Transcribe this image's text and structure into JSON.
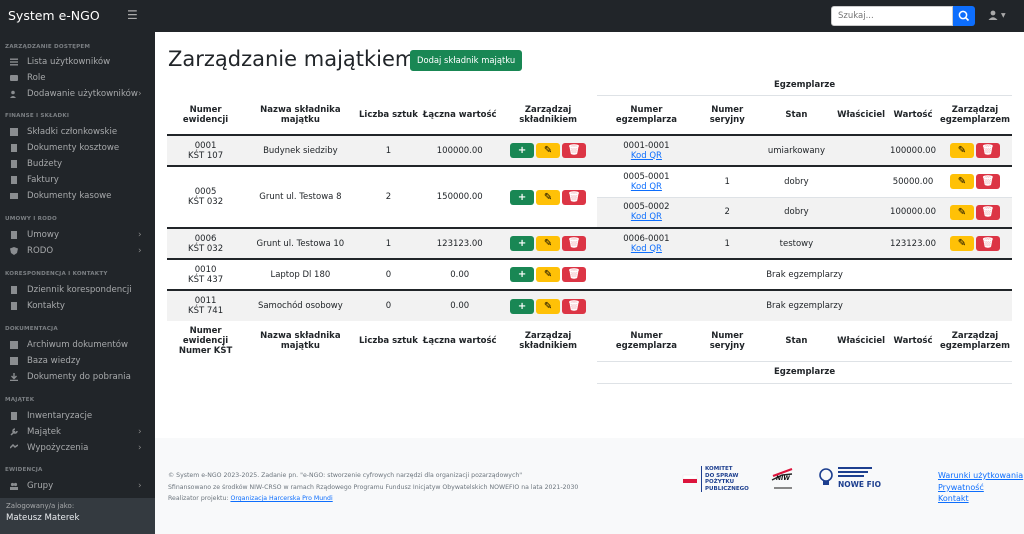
{
  "app": {
    "title": "System e-NGO",
    "search_placeholder": "Szukaj..."
  },
  "sidebar": {
    "sections": [
      {
        "label": "Zarządzanie dostępem",
        "items": [
          {
            "label": "Lista użytkowników",
            "icon": "list-icon"
          },
          {
            "label": "Role",
            "icon": "id-card-icon"
          },
          {
            "label": "Dodawanie użytkowników",
            "icon": "add-user-icon",
            "submenu": true
          }
        ]
      },
      {
        "label": "Finanse i składki",
        "items": [
          {
            "label": "Składki członkowskie",
            "icon": "table-icon"
          },
          {
            "label": "Dokumenty kosztowe",
            "icon": "receipt-icon"
          },
          {
            "label": "Budżety",
            "icon": "file-icon"
          },
          {
            "label": "Faktury",
            "icon": "invoice-icon"
          },
          {
            "label": "Dokumenty kasowe",
            "icon": "cash-icon"
          }
        ]
      },
      {
        "label": "Umowy i RODO",
        "items": [
          {
            "label": "Umowy",
            "icon": "document-icon",
            "submenu": true
          },
          {
            "label": "RODO",
            "icon": "shield-icon",
            "submenu": true
          }
        ]
      },
      {
        "label": "Korespondencja i kontakty",
        "items": [
          {
            "label": "Dziennik korespondencji",
            "icon": "journal-icon"
          },
          {
            "label": "Kontakty",
            "icon": "contact-icon"
          }
        ]
      },
      {
        "label": "Dokumentacja",
        "items": [
          {
            "label": "Archiwum dokumentów",
            "icon": "archive-icon"
          },
          {
            "label": "Baza wiedzy",
            "icon": "book-icon"
          },
          {
            "label": "Dokumenty do pobrania",
            "icon": "download-icon"
          }
        ]
      },
      {
        "label": "Majątek",
        "items": [
          {
            "label": "Inwentaryzacje",
            "icon": "clipboard-icon"
          },
          {
            "label": "Majątek",
            "icon": "wrench-icon",
            "submenu": true
          },
          {
            "label": "Wypożyczenia",
            "icon": "handshake-icon",
            "submenu": true
          }
        ]
      },
      {
        "label": "Ewidencja",
        "items": [
          {
            "label": "Grupy",
            "icon": "group-icon",
            "submenu": true
          }
        ]
      }
    ],
    "logged_in_label": "Zalogowany/a jako:",
    "user_name": "Mateusz Materek"
  },
  "page": {
    "title": "Zarządzanie majątkiem",
    "add_button": "Dodaj składnik majątku"
  },
  "table": {
    "group_header": "Egzemplarze",
    "headers": [
      "Numer ewidencji",
      "Nazwa składnika majątku",
      "Liczba sztuk",
      "Łączna wartość",
      "Zarządzaj składnikiem",
      "Numer egzemplarza",
      "Numer seryjny",
      "Stan",
      "Właściciel",
      "Wartość",
      "Zarządzaj egzemplarzem"
    ],
    "footer_headers": [
      "Numer ewidencji Numer KŚT",
      "Nazwa składnika majątku",
      "Liczba sztuk",
      "Łączna wartość",
      "Zarządzaj składnikiem",
      "Numer egzemplarza",
      "Numer seryjny",
      "Stan",
      "Właściciel",
      "Wartość",
      "Zarządzaj egzemplarzem"
    ],
    "qr_label": "Kod QR",
    "no_copies": "Brak egzemplarzy",
    "rows": [
      {
        "ev": "0001",
        "kst": "KŚT 107",
        "name": "Budynek siedziby",
        "qty": "1",
        "total": "100000.00",
        "copies": [
          {
            "num": "0001-0001",
            "serial": "",
            "state": "umiarkowany",
            "owner": "",
            "value": "100000.00"
          }
        ]
      },
      {
        "ev": "0005",
        "kst": "KŚT 032",
        "name": "Grunt ul. Testowa 8",
        "qty": "2",
        "total": "150000.00",
        "copies": [
          {
            "num": "0005-0001",
            "serial": "1",
            "state": "dobry",
            "owner": "",
            "value": "50000.00"
          },
          {
            "num": "0005-0002",
            "serial": "2",
            "state": "dobry",
            "owner": "",
            "value": "100000.00"
          }
        ]
      },
      {
        "ev": "0006",
        "kst": "KŚT 032",
        "name": "Grunt ul. Testowa 10",
        "qty": "1",
        "total": "123123.00",
        "copies": [
          {
            "num": "0006-0001",
            "serial": "1",
            "state": "testowy",
            "owner": "",
            "value": "123123.00"
          }
        ]
      },
      {
        "ev": "0010",
        "kst": "KŚT 437",
        "name": "Laptop Dl 180",
        "qty": "0",
        "total": "0.00",
        "copies": []
      },
      {
        "ev": "0011",
        "kst": "KŚT 741",
        "name": "Samochód osobowy",
        "qty": "0",
        "total": "0.00",
        "copies": []
      }
    ]
  },
  "footer": {
    "line1": "© System e-NGO 2023-2025. Zadanie pn. \"e-NGO: stworzenie cyfrowych narzędzi dla organizacji pozarządowych\"",
    "line2": "Sfinansowano ze środków NIW-CRSO w ramach Rządowego Programu Fundusz Inicjatyw Obywatelskich NOWEFIO na lata 2021-2030",
    "line3_prefix": "Realizator projektu: ",
    "line3_link": "Organizacja Harcerska Pro Mundi",
    "logo1": [
      "KOMITET",
      "DO SPRAW",
      "POŻYTKU",
      "PUBLICZNEGO"
    ],
    "logo2": "NIW",
    "logo3": "NOWE FIO",
    "links": [
      "Warunki użytkowania",
      "Prywatność",
      "Kontakt"
    ]
  },
  "colors": {
    "sidebar": "#212529",
    "primary": "#0d6efd",
    "success": "#198754",
    "warning": "#ffc107",
    "danger": "#dc3545"
  }
}
